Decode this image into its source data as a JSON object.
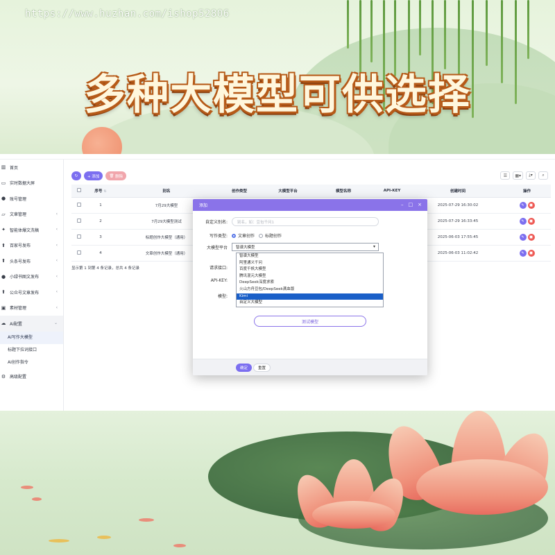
{
  "watermark": "https://www.huzhan.com/ishop52806",
  "headline": "多种大模型可供选择",
  "toolbar": {
    "add_label": "+ 添加",
    "delete_label": "删除"
  },
  "sidebar": {
    "items": [
      {
        "label": "首页",
        "icon": "chart-icon"
      },
      {
        "label": "实时数据大屏",
        "icon": "monitor-icon"
      },
      {
        "label": "账号管理",
        "icon": "user-icon"
      },
      {
        "label": "文章管理",
        "icon": "folder-icon",
        "arrow": true
      },
      {
        "label": "智能体爆文洗稿",
        "icon": "sparkle-icon",
        "arrow": true
      },
      {
        "label": "百家号发布",
        "icon": "upload-icon",
        "arrow": true
      },
      {
        "label": "头条号发布",
        "icon": "upload-icon",
        "arrow": true
      },
      {
        "label": "小绿书图文发布",
        "icon": "user-icon",
        "arrow": true
      },
      {
        "label": "公众号文章发布",
        "icon": "upload-icon",
        "arrow": true
      },
      {
        "label": "素材管理",
        "icon": "image-icon",
        "arrow": true
      },
      {
        "label": "AI配置",
        "icon": "cloud-icon",
        "arrow": true,
        "open": true
      }
    ],
    "sub_items": [
      {
        "label": "AI写作大模型",
        "active": true
      },
      {
        "label": "标题下拉词接口"
      },
      {
        "label": "AI创作指令"
      }
    ],
    "last_item": {
      "label": "高级配置",
      "icon": "gear-icon"
    }
  },
  "table": {
    "headers": [
      "序号",
      "别名",
      "创作类型",
      "大模型平台",
      "模型名称",
      "API-KEY",
      "创建时间",
      "操作"
    ],
    "rows": [
      {
        "no": "1",
        "alias": "7月29大模型",
        "time": "2025-07-29 16:30:02"
      },
      {
        "no": "2",
        "alias": "7月29大模型测试",
        "time": "2025-07-29 16:33:45"
      },
      {
        "no": "3",
        "alias": "标题创作大模型（通用）",
        "time": "2025-06-03 17:55:45"
      },
      {
        "no": "4",
        "alias": "文章创作大模型（通用）",
        "time": "2025-06-03 11:02:42"
      }
    ],
    "pager": "显示第 1 到第 4 条记录，总共 4 条记录"
  },
  "modal": {
    "title": "添加",
    "ctrl_min": "–",
    "ctrl_max": "□",
    "ctrl_close": "×",
    "alias_label": "自定义别名:",
    "alias_placeholder": "别名，如：豆包千问1",
    "type_label": "写作类型:",
    "type_option1": "文章创作",
    "type_option2": "标题创作",
    "platform_label": "大模型平台",
    "platform_selected": "智谱大模型",
    "platform_options": [
      "智谱大模型",
      "阿里通义千问",
      "百度千帆大模型",
      "腾讯混元大模型",
      "DeepSeek深度求索",
      "火山方舟豆包/DeepSeek满血版",
      "Kimi",
      "自定义大模型"
    ],
    "platform_highlight": "Kimi",
    "endpoint_label": "请求接口:",
    "apikey_label": "API-KEY:",
    "model_label": "模型:",
    "test_button": "测试模型",
    "ok_button": "确定",
    "reset_button": "重置"
  },
  "colors": {
    "accent": "#7c6ff0",
    "modal_header": "#8a73e9",
    "delete": "#ee5a55",
    "highlight": "#1a5fc8"
  }
}
